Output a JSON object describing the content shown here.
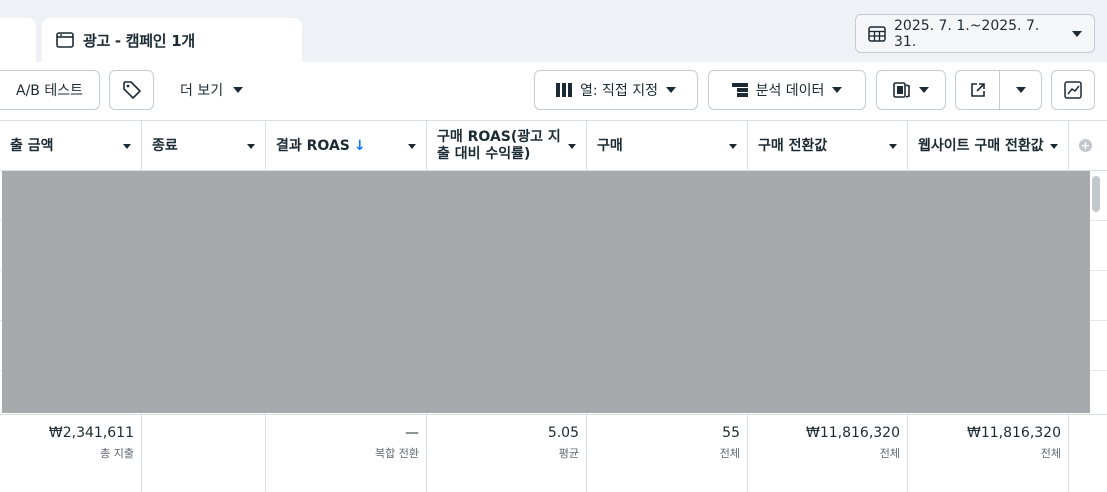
{
  "header": {
    "tab_label": "광고 - 캠페인 1개",
    "date_range": "2025. 7. 1.~2025. 7. 31."
  },
  "toolbar": {
    "ab_test_label": "A/B 테스트",
    "more_label": "더 보기",
    "columns_label": "열: 직접 지정",
    "breakdown_label": "분석 데이터"
  },
  "table": {
    "columns": [
      {
        "label": "출 금액"
      },
      {
        "label": "종료"
      },
      {
        "label": "결과 ROAS",
        "sort": "↓"
      },
      {
        "label": "구매 ROAS(광고 지출 대비 수익률)"
      },
      {
        "label": "구매"
      },
      {
        "label": "구매 전환값"
      },
      {
        "label": "웹사이트 구매 전환값"
      }
    ],
    "summary": [
      {
        "value": "₩2,341,611",
        "sub": "총 지출"
      },
      {
        "value": "",
        "sub": ""
      },
      {
        "value": "—",
        "sub": "복합 전환"
      },
      {
        "value": "5.05",
        "sub": "평균"
      },
      {
        "value": "55",
        "sub": "전체"
      },
      {
        "value": "₩11,816,320",
        "sub": "전체"
      },
      {
        "value": "₩11,816,320",
        "sub": "전체"
      }
    ]
  },
  "colors": {
    "accent": "#0a78ff",
    "redacted": "#a8a9ad",
    "border": "#dadde1"
  }
}
